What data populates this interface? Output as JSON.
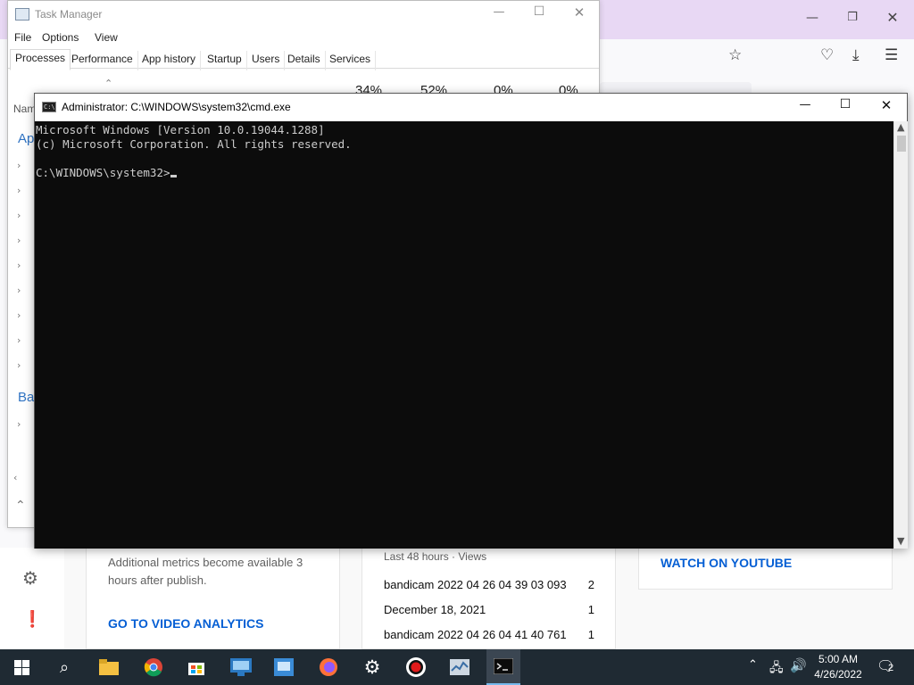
{
  "taskmanager": {
    "title": "Task Manager",
    "menu": [
      "File",
      "Options",
      "View"
    ],
    "tabs": [
      "Processes",
      "Performance",
      "App history",
      "Startup",
      "Users",
      "Details",
      "Services"
    ],
    "active_tab": "Processes",
    "usage": [
      "34%",
      "52%",
      "0%",
      "0%"
    ],
    "col_name": "Nam",
    "group_apps": "Ap",
    "group_bg": "Bac"
  },
  "cmd": {
    "title": "Administrator: C:\\WINDOWS\\system32\\cmd.exe",
    "lines": [
      "Microsoft Windows [Version 10.0.19044.1288]",
      "(c) Microsoft Corporation. All rights reserved.",
      "",
      "C:\\WINDOWS\\system32>"
    ]
  },
  "youtube": {
    "metrics_note": "Additional metrics become available 3 hours after publish.",
    "analytics_link": "GO TO VIDEO ANALYTICS",
    "views_header": "Last 48 hours · Views",
    "rows": [
      {
        "label": "bandicam 2022 04 26 04 39 03 093",
        "count": "2"
      },
      {
        "label": "December 18, 2021",
        "count": "1"
      },
      {
        "label": "bandicam 2022 04 26 04 41 40 761",
        "count": "1"
      }
    ],
    "watch_link": "WATCH ON YOUTUBE"
  },
  "taskbar": {
    "time": "5:00 AM",
    "date": "4/26/2022",
    "notification_count": "2"
  },
  "colors": {
    "browser_titlebar": "#e8d8f4",
    "youtube_link": "#065fd4",
    "console_bg": "#0c0c0c",
    "taskbar_bg": "#1f2a33"
  }
}
